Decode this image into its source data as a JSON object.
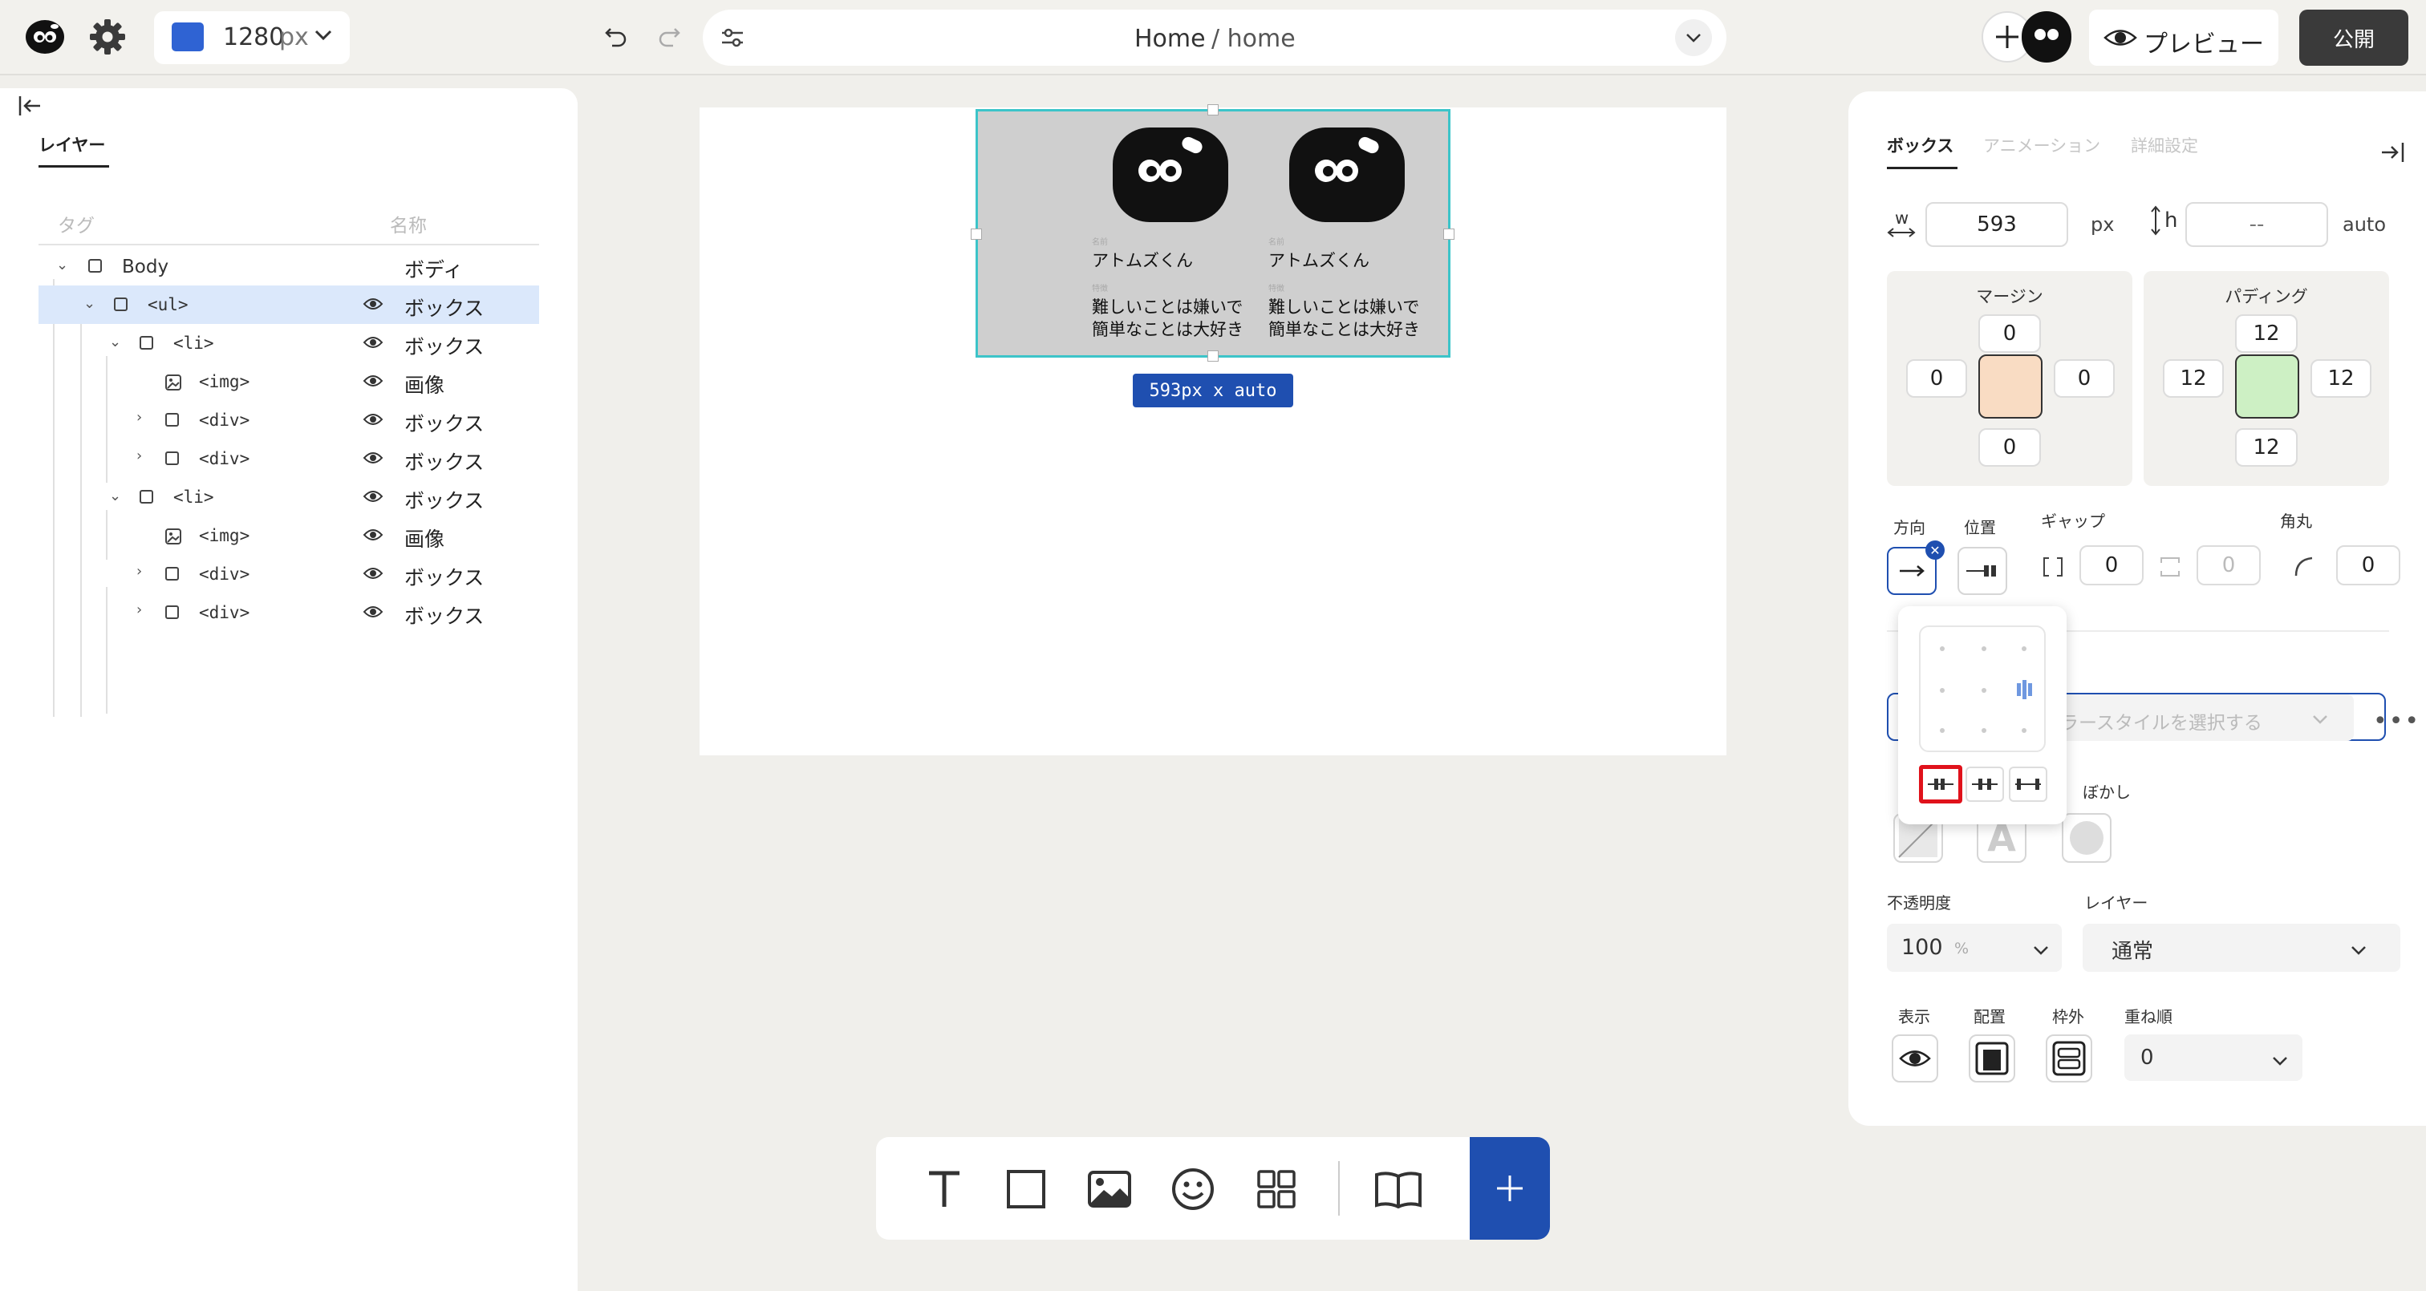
{
  "topbar": {
    "width_value": "1280",
    "width_unit": "px",
    "breadcrumb_page": "Home",
    "breadcrumb_path": "/ home",
    "preview_label": "プレビュー",
    "publish_label": "公開"
  },
  "layers": {
    "tab_label": "レイヤー",
    "col_tag": "タグ",
    "col_name": "名称",
    "rows": [
      {
        "tag": "Body",
        "name": "ボディ"
      },
      {
        "tag": "<ul>",
        "name": "ボックス"
      },
      {
        "tag": "<li>",
        "name": "ボックス"
      },
      {
        "tag": "<img>",
        "name": "画像"
      },
      {
        "tag": "<div>",
        "name": "ボックス"
      },
      {
        "tag": "<div>",
        "name": "ボックス"
      },
      {
        "tag": "<li>",
        "name": "ボックス"
      },
      {
        "tag": "<img>",
        "name": "画像"
      },
      {
        "tag": "<div>",
        "name": "ボックス"
      },
      {
        "tag": "<div>",
        "name": "ボックス"
      }
    ]
  },
  "canvas": {
    "cards": [
      {
        "tiny1": "名前",
        "name": "アトムズくん",
        "tiny2": "特徴",
        "line1": "難しいことは嫌いで",
        "line2": "簡単なことは大好き"
      },
      {
        "tiny1": "名前",
        "name": "アトムズくん",
        "tiny2": "特徴",
        "line1": "難しいことは嫌いで",
        "line2": "簡単なことは大好き"
      }
    ],
    "size_badge": "593px x auto"
  },
  "props": {
    "tabs": [
      "ボックス",
      "アニメーション",
      "詳細設定"
    ],
    "w_label": "w",
    "w_value": "593",
    "w_unit": "px",
    "h_label": "h",
    "h_value": "--",
    "h_unit": "auto",
    "margin_label": "マージン",
    "margin": {
      "top": "0",
      "left": "0",
      "right": "0",
      "bottom": "0"
    },
    "padding_label": "パディング",
    "padding": {
      "top": "12",
      "left": "12",
      "right": "12",
      "bottom": "12"
    },
    "direction_label": "方向",
    "position_label": "位置",
    "gap_label": "ギャップ",
    "gap_value": "0",
    "gap_value2": "0",
    "radius_label": "角丸",
    "radius_value": "0",
    "color_style_placeholder": "ラースタイルを選択する",
    "blur_label": "ぼかし",
    "opacity_label": "不透明度",
    "opacity_value": "100",
    "opacity_unit": "%",
    "layer_label": "レイヤー",
    "layer_value": "通常",
    "display_label": "表示",
    "placement_label": "配置",
    "overflow_label": "枠外",
    "zorder_label": "重ね順",
    "zorder_value": "0"
  },
  "colors": {
    "accent": "#1f4fb0",
    "selection": "#3cc4c9",
    "highlight_row": "#dbe8fb",
    "margin_fill": "#f9dcc3",
    "padding_fill": "#cdf0c4",
    "publish_bg": "#3a3a3a",
    "callout_red": "#e0121b"
  }
}
